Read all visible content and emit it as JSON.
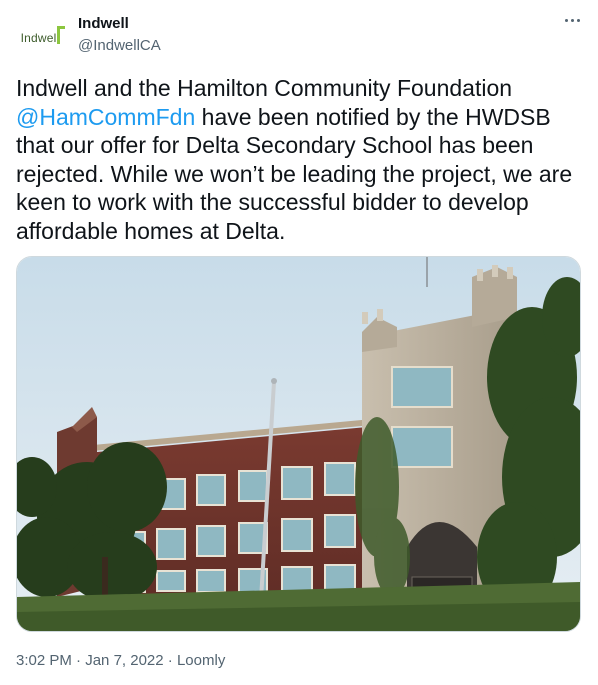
{
  "account": {
    "logo_text": "Indwell",
    "name": "Indwell",
    "handle": "@IndwellCA"
  },
  "tweet": {
    "text_before": "Indwell and the Hamilton Community Foundation ",
    "mention": "@HamCommFdn",
    "text_after": " have been notified by the HWDSB that our offer for Delta Secondary School has been rejected. While we won’t be leading the project, we are keen to work with the successful bidder to develop affordable homes at Delta."
  },
  "meta": {
    "time": "3:02 PM",
    "separator": " · ",
    "date": "Jan 7, 2022",
    "source": "Loomly"
  },
  "icons": {
    "more": "more-options-icon"
  },
  "colors": {
    "link": "#1d9bf0",
    "text": "#0f1419",
    "secondary": "#536471",
    "border": "#cfd9de"
  }
}
